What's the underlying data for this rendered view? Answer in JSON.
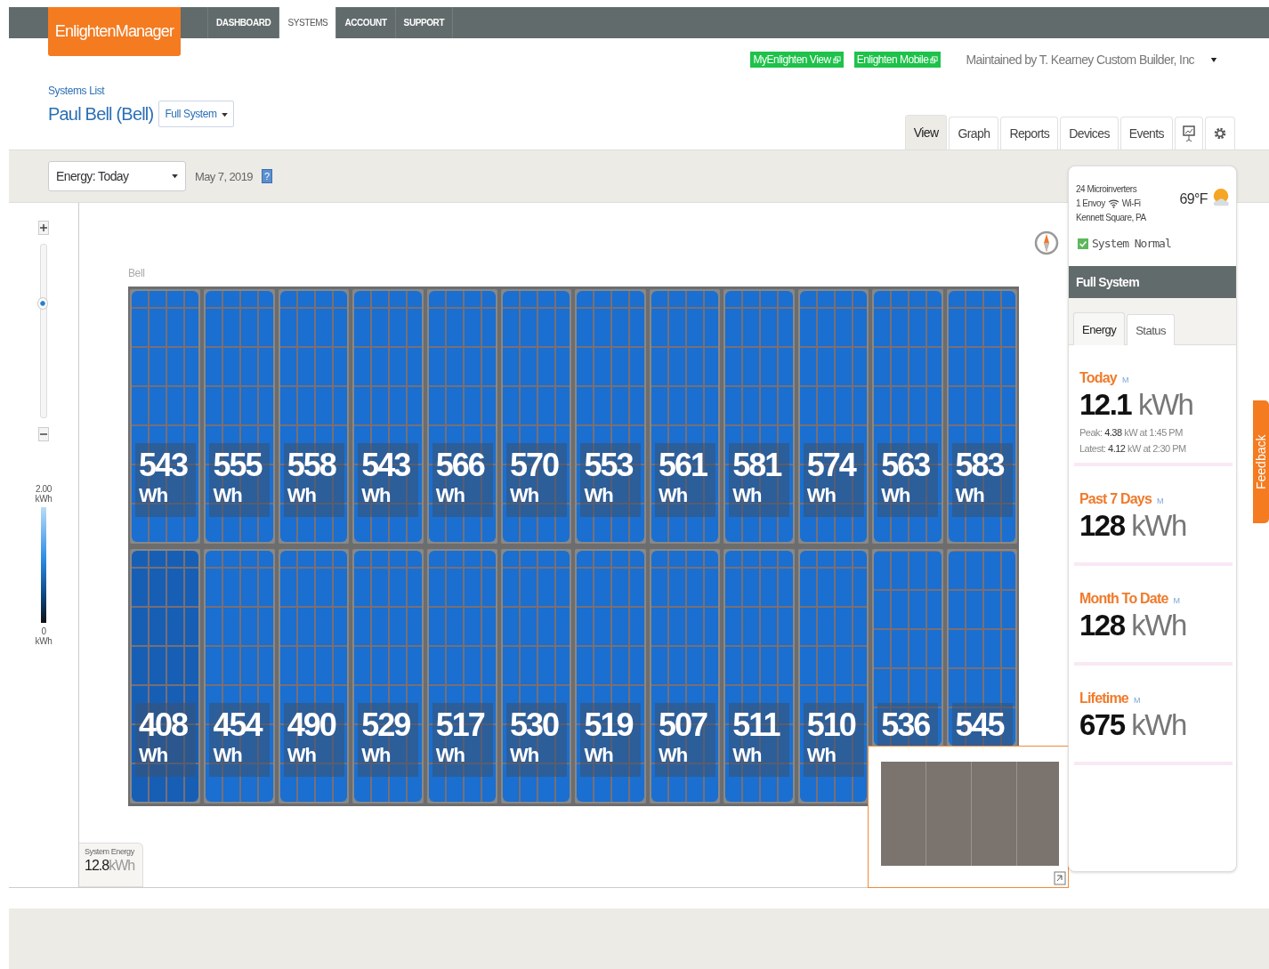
{
  "header": {
    "logo": "EnlightenManager",
    "nav": [
      {
        "label": "DASHBOARD",
        "selected": false
      },
      {
        "label": "SYSTEMS",
        "selected": true
      },
      {
        "label": "ACCOUNT",
        "selected": false
      },
      {
        "label": "SUPPORT",
        "selected": false
      }
    ]
  },
  "links": [
    "MyEnlighten View",
    "Enlighten Mobile"
  ],
  "maintained_by": "Maintained by T. Kearney Custom Builder, Inc",
  "breadcrumb": "Systems List",
  "system_name": "Paul Bell (Bell)",
  "scope_button": "Full System",
  "view_tabs": [
    {
      "label": "View",
      "selected": true
    },
    {
      "label": "Graph",
      "selected": false
    },
    {
      "label": "Reports",
      "selected": false
    },
    {
      "label": "Devices",
      "selected": false
    },
    {
      "label": "Events",
      "selected": false
    }
  ],
  "toolbar": {
    "mode_select": "Energy: Today",
    "date": "May 7, 2019",
    "help": "?"
  },
  "zoom": {
    "level": 0.66
  },
  "legend": {
    "max": "2.00",
    "max_unit": "kWh",
    "min": "0",
    "min_unit": "kWh"
  },
  "array": {
    "name": "Bell",
    "rows": [
      [
        {
          "value": "543",
          "unit": "Wh"
        },
        {
          "value": "555",
          "unit": "Wh"
        },
        {
          "value": "558",
          "unit": "Wh"
        },
        {
          "value": "543",
          "unit": "Wh"
        },
        {
          "value": "566",
          "unit": "Wh"
        },
        {
          "value": "570",
          "unit": "Wh"
        },
        {
          "value": "553",
          "unit": "Wh"
        },
        {
          "value": "561",
          "unit": "Wh"
        },
        {
          "value": "581",
          "unit": "Wh"
        },
        {
          "value": "574",
          "unit": "Wh"
        },
        {
          "value": "563",
          "unit": "Wh"
        },
        {
          "value": "583",
          "unit": "Wh"
        }
      ],
      [
        {
          "value": "408",
          "unit": "Wh"
        },
        {
          "value": "454",
          "unit": "Wh"
        },
        {
          "value": "490",
          "unit": "Wh"
        },
        {
          "value": "529",
          "unit": "Wh"
        },
        {
          "value": "517",
          "unit": "Wh"
        },
        {
          "value": "530",
          "unit": "Wh"
        },
        {
          "value": "519",
          "unit": "Wh"
        },
        {
          "value": "507",
          "unit": "Wh"
        },
        {
          "value": "511",
          "unit": "Wh"
        },
        {
          "value": "510",
          "unit": "Wh"
        },
        {
          "value": "536"
        },
        {
          "value": "545"
        }
      ]
    ]
  },
  "system_energy": {
    "label": "System Energy",
    "value": "12.8",
    "unit": "kWh"
  },
  "summary": {
    "microinverters": "24 Microinverters",
    "envoy": "1 Envoy",
    "connection": "Wi-Fi",
    "location": "Kennett Square, PA",
    "temperature": "69°F",
    "status": "System Normal"
  },
  "panel_title": "Full System",
  "panel_tabs": [
    {
      "label": "Energy",
      "selected": true
    },
    {
      "label": "Status",
      "selected": false
    }
  ],
  "stats": [
    {
      "label": "Today",
      "badge": "M",
      "value": "12.1",
      "unit": "kWh",
      "details": [
        "Peak: **4.38** kW at 1:45 PM",
        "Latest: **4.12** kW at 2:30 PM"
      ]
    },
    {
      "label": "Past 7 Days",
      "badge": "M",
      "value": "128",
      "unit": "kWh"
    },
    {
      "label": "Month To Date",
      "badge": "M",
      "value": "128",
      "unit": "kWh"
    },
    {
      "label": "Lifetime",
      "badge": "M",
      "value": "675",
      "unit": "kWh"
    }
  ],
  "feedback": "Feedback"
}
